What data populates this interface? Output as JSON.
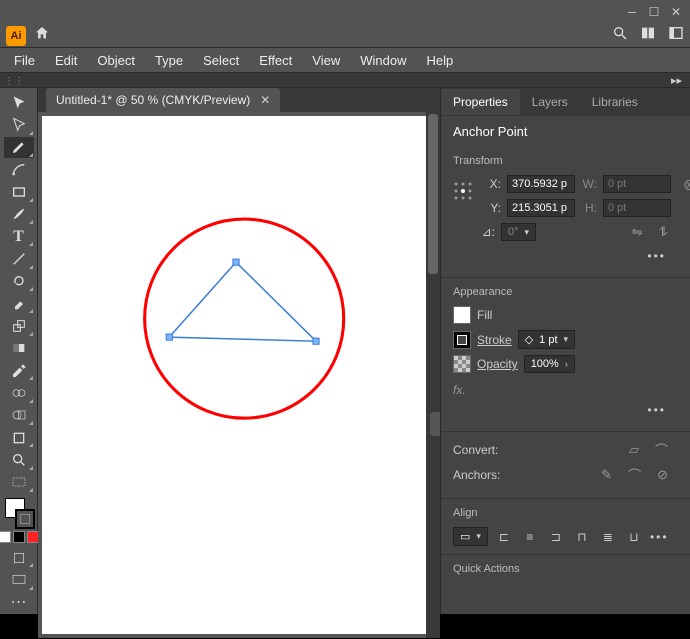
{
  "app": {
    "title": "Adobe Illustrator"
  },
  "menu": {
    "file": "File",
    "edit": "Edit",
    "object": "Object",
    "type": "Type",
    "select": "Select",
    "effect": "Effect",
    "view": "View",
    "window": "Window",
    "help": "Help"
  },
  "document": {
    "tab_title": "Untitled-1* @ 50 % (CMYK/Preview)"
  },
  "panel": {
    "tabs": {
      "properties": "Properties",
      "layers": "Layers",
      "libraries": "Libraries"
    },
    "selection_type": "Anchor Point",
    "transform": {
      "title": "Transform",
      "x_label": "X:",
      "x_value": "370.5932 p",
      "y_label": "Y:",
      "y_value": "215.3051 p",
      "w_label": "W:",
      "w_value": "0 pt",
      "h_label": "H:",
      "h_value": "0 pt",
      "angle_label": "⊿:",
      "angle_value": "0°"
    },
    "appearance": {
      "title": "Appearance",
      "fill_label": "Fill",
      "stroke_label": "Stroke",
      "stroke_value": "1 pt",
      "opacity_label": "Opacity",
      "opacity_value": "100%",
      "fx_label": "fx."
    },
    "convert": {
      "title": "Convert:"
    },
    "anchors": {
      "title": "Anchors:"
    },
    "align": {
      "title": "Align"
    },
    "quick": {
      "title": "Quick Actions"
    }
  }
}
